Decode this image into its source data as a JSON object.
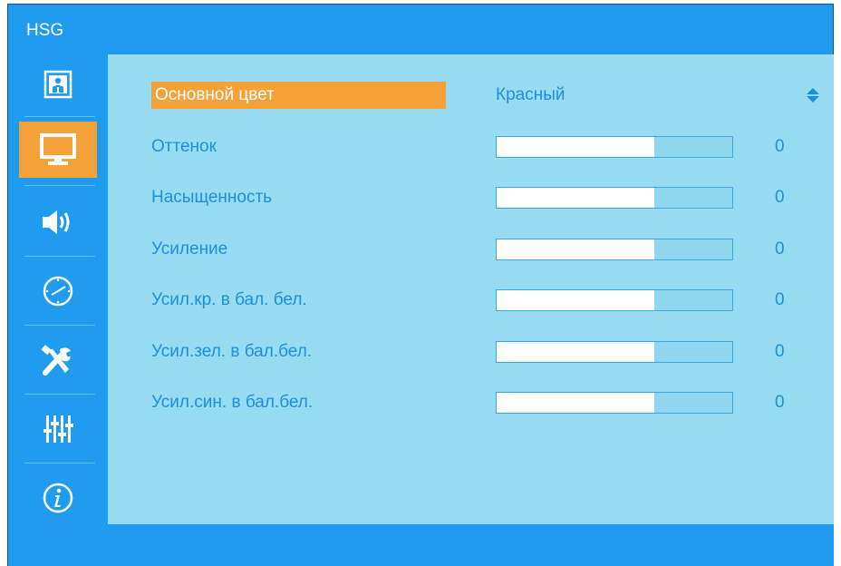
{
  "header": {
    "title": "HSG"
  },
  "sidebar": {
    "items": [
      {
        "icon": "picture-person-icon",
        "active": false
      },
      {
        "icon": "monitor-icon",
        "active": true
      },
      {
        "icon": "speaker-icon",
        "active": false
      },
      {
        "icon": "clock-icon",
        "active": false
      },
      {
        "icon": "tools-icon",
        "active": false
      },
      {
        "icon": "equalizer-icon",
        "active": false
      },
      {
        "icon": "info-icon",
        "active": false
      }
    ]
  },
  "menu": {
    "primary": {
      "label": "Основной цвет",
      "value": "Красный"
    },
    "settings": [
      {
        "label": "Оттенок",
        "value": "0",
        "level": 0.67
      },
      {
        "label": "Насыщенность",
        "value": "0",
        "level": 0.67
      },
      {
        "label": "Усиление",
        "value": "0",
        "level": 0.67
      },
      {
        "label": "Усил.кр. в бал. бел.",
        "value": "0",
        "level": 0.67
      },
      {
        "label": "Усил.зел. в бал.бел.",
        "value": "0",
        "level": 0.67
      },
      {
        "label": "Усил.син. в бал.бел.",
        "value": "0",
        "level": 0.67
      }
    ]
  },
  "colors": {
    "frame": "#1f9bef",
    "content": "#98dcf2",
    "accent": "#f5a13a",
    "text": "#1a8fe0"
  }
}
